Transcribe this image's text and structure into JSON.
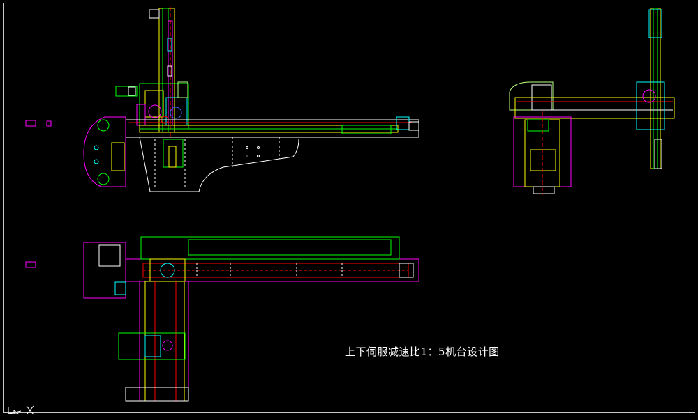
{
  "drawing": {
    "title": "上下伺服减速比1：5机台设计图"
  },
  "colors": {
    "background": "#000000",
    "frame": "#c8c8c8",
    "white": "#ffffff",
    "yellow": "#ffff00",
    "green": "#00ff00",
    "cyan": "#00ffff",
    "magenta": "#ff00ff",
    "red": "#ff0000",
    "blue": "#3a6bff",
    "lightgreen": "#b8ff7a",
    "orange": "#ffb000"
  },
  "icons": {
    "ucs": "ucs-axis-icon"
  }
}
